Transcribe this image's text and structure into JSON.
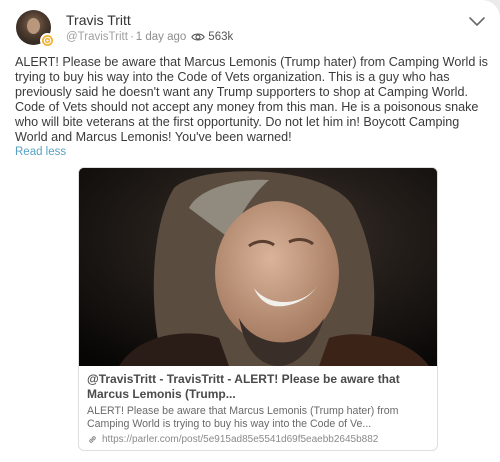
{
  "author": {
    "name": "Travis Tritt",
    "handle": "@TravisTritt",
    "time": "1 day ago",
    "views": "563k",
    "avatar_icon": "user-avatar",
    "badge_icon": "verified-badge-icon"
  },
  "post": {
    "text": "ALERT! Please be aware that Marcus Lemonis (Trump hater) from Camping World is trying to buy his way into the Code of Vets organization. This is a guy who has previously said he doesn't want any Trump supporters to shop at Camping World. Code of Vets should not accept any money from this man. He is a poisonous snake who will bite veterans at the first opportunity. Do not let him in! Boycott Camping World and Marcus Lemonis! You've been warned!",
    "read_less": "Read less"
  },
  "preview": {
    "title": "@TravisTritt - TravisTritt - ALERT! Please be aware that Marcus Lemonis (Trump...",
    "description": "ALERT! Please be aware that Marcus Lemonis (Trump hater) from Camping World is trying to buy his way into the Code of Ve...",
    "url": "https://parler.com/post/5e915ad85e5541d69f5eaebb2645b882"
  },
  "colors": {
    "link": "#5aa0c2",
    "badge": "#f3b233",
    "text": "#3a3a3a"
  }
}
